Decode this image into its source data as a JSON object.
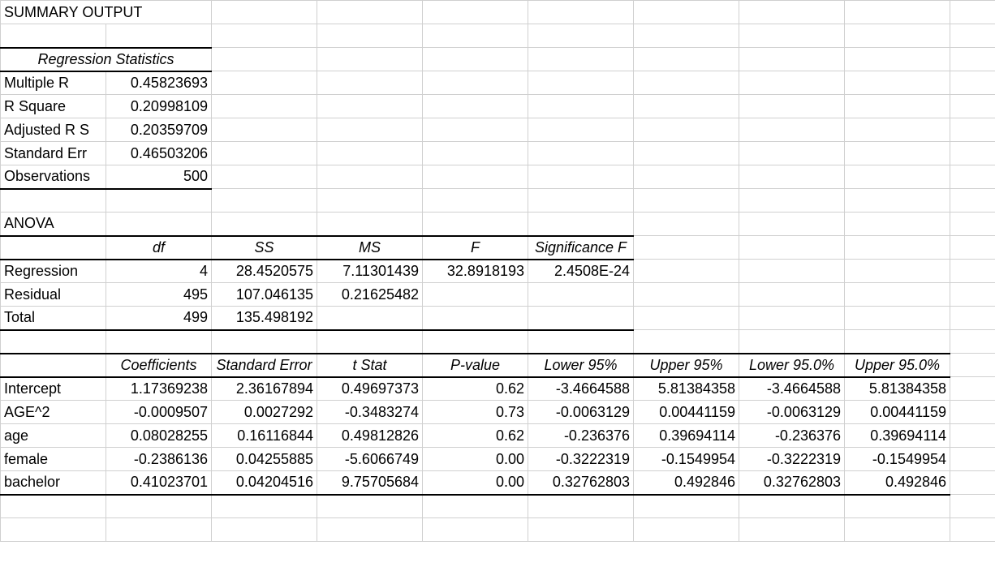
{
  "title": "SUMMARY OUTPUT",
  "regStatsHeader": "Regression Statistics",
  "regStats": {
    "multipleR": {
      "label": "Multiple R",
      "value": "0.45823693"
    },
    "rSquare": {
      "label": "R Square",
      "value": "0.20998109"
    },
    "adjRSquare": {
      "label": "Adjusted R S",
      "value": "0.20359709"
    },
    "stdErr": {
      "label": "Standard Err",
      "value": "0.46503206"
    },
    "obs": {
      "label": "Observations",
      "value": "500"
    }
  },
  "anovaLabel": "ANOVA",
  "anovaHeaders": {
    "df": "df",
    "ss": "SS",
    "ms": "MS",
    "f": "F",
    "sigF": "Significance F"
  },
  "anova": {
    "regression": {
      "label": "Regression",
      "df": "4",
      "ss": "28.4520575",
      "ms": "7.11301439",
      "f": "32.8918193",
      "sigF": "2.4508E-24"
    },
    "residual": {
      "label": "Residual",
      "df": "495",
      "ss": "107.046135",
      "ms": "0.21625482"
    },
    "total": {
      "label": "Total",
      "df": "499",
      "ss": "135.498192"
    }
  },
  "coefHeaders": {
    "coef": "Coefficients",
    "se": "Standard Error",
    "t": "t Stat",
    "p": "P-value",
    "l95": "Lower 95%",
    "u95": "Upper 95%",
    "l95b": "Lower 95.0%",
    "u95b": "Upper 95.0%"
  },
  "coef": {
    "intercept": {
      "label": "Intercept",
      "c": "1.17369238",
      "se": "2.36167894",
      "t": "0.49697373",
      "p": "0.62",
      "l95": "-3.4664588",
      "u95": "5.81384358",
      "l95b": "-3.4664588",
      "u95b": "5.81384358"
    },
    "age2": {
      "label": "AGE^2",
      "c": "-0.0009507",
      "se": "0.0027292",
      "t": "-0.3483274",
      "p": "0.73",
      "l95": "-0.0063129",
      "u95": "0.00441159",
      "l95b": "-0.0063129",
      "u95b": "0.00441159"
    },
    "age": {
      "label": "age",
      "c": "0.08028255",
      "se": "0.16116844",
      "t": "0.49812826",
      "p": "0.62",
      "l95": "-0.236376",
      "u95": "0.39694114",
      "l95b": "-0.236376",
      "u95b": "0.39694114"
    },
    "female": {
      "label": "female",
      "c": "-0.2386136",
      "se": "0.04255885",
      "t": "-5.6066749",
      "p": "0.00",
      "l95": "-0.3222319",
      "u95": "-0.1549954",
      "l95b": "-0.3222319",
      "u95b": "-0.1549954"
    },
    "bachelor": {
      "label": "bachelor",
      "c": "0.41023701",
      "se": "0.04204516",
      "t": "9.75705684",
      "p": "0.00",
      "l95": "0.32762803",
      "u95": "0.492846",
      "l95b": "0.32762803",
      "u95b": "0.492846"
    }
  },
  "chart_data": {
    "type": "table",
    "title": "SUMMARY OUTPUT",
    "sections": {
      "regression_statistics": {
        "Multiple R": 0.45823693,
        "R Square": 0.20998109,
        "Adjusted R Square": 0.20359709,
        "Standard Error": 0.46503206,
        "Observations": 500
      },
      "anova": {
        "columns": [
          "df",
          "SS",
          "MS",
          "F",
          "Significance F"
        ],
        "rows": [
          {
            "name": "Regression",
            "df": 4,
            "SS": 28.4520575,
            "MS": 7.11301439,
            "F": 32.8918193,
            "Significance F": 2.4508e-24
          },
          {
            "name": "Residual",
            "df": 495,
            "SS": 107.046135,
            "MS": 0.21625482
          },
          {
            "name": "Total",
            "df": 499,
            "SS": 135.498192
          }
        ]
      },
      "coefficients": {
        "columns": [
          "Coefficients",
          "Standard Error",
          "t Stat",
          "P-value",
          "Lower 95%",
          "Upper 95%",
          "Lower 95.0%",
          "Upper 95.0%"
        ],
        "rows": [
          {
            "name": "Intercept",
            "Coefficients": 1.17369238,
            "Standard Error": 2.36167894,
            "t Stat": 0.49697373,
            "P-value": 0.62,
            "Lower 95%": -3.4664588,
            "Upper 95%": 5.81384358,
            "Lower 95.0%": -3.4664588,
            "Upper 95.0%": 5.81384358
          },
          {
            "name": "AGE^2",
            "Coefficients": -0.0009507,
            "Standard Error": 0.0027292,
            "t Stat": -0.3483274,
            "P-value": 0.73,
            "Lower 95%": -0.0063129,
            "Upper 95%": 0.00441159,
            "Lower 95.0%": -0.0063129,
            "Upper 95.0%": 0.00441159
          },
          {
            "name": "age",
            "Coefficients": 0.08028255,
            "Standard Error": 0.16116844,
            "t Stat": 0.49812826,
            "P-value": 0.62,
            "Lower 95%": -0.236376,
            "Upper 95%": 0.39694114,
            "Lower 95.0%": -0.236376,
            "Upper 95.0%": 0.39694114
          },
          {
            "name": "female",
            "Coefficients": -0.2386136,
            "Standard Error": 0.04255885,
            "t Stat": -5.6066749,
            "P-value": 0.0,
            "Lower 95%": -0.3222319,
            "Upper 95%": -0.1549954,
            "Lower 95.0%": -0.3222319,
            "Upper 95.0%": -0.1549954
          },
          {
            "name": "bachelor",
            "Coefficients": 0.41023701,
            "Standard Error": 0.04204516,
            "t Stat": 9.75705684,
            "P-value": 0.0,
            "Lower 95%": 0.32762803,
            "Upper 95%": 0.492846,
            "Lower 95.0%": 0.32762803,
            "Upper 95.0%": 0.492846
          }
        ]
      }
    }
  }
}
